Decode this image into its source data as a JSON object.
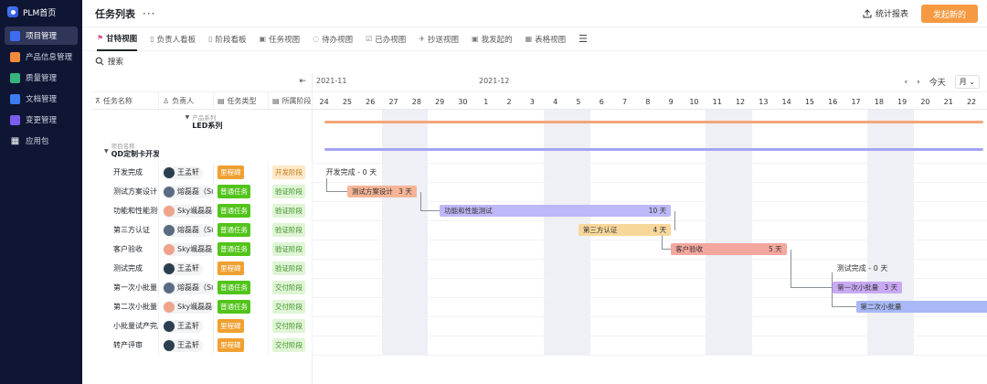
{
  "sidebar": {
    "brand": "PLM首页",
    "items": [
      {
        "label": "项目管理",
        "icon": "project-icon",
        "color": "#3d6cf0",
        "active": true
      },
      {
        "label": "产品信息管理",
        "icon": "product-icon",
        "color": "#f08a3d",
        "active": false
      },
      {
        "label": "质量管理",
        "icon": "quality-icon",
        "color": "#36b37e",
        "active": false
      },
      {
        "label": "文档管理",
        "icon": "document-icon",
        "color": "#3d7cf0",
        "active": false
      },
      {
        "label": "变更管理",
        "icon": "change-icon",
        "color": "#7b5cf0",
        "active": false
      },
      {
        "label": "应用包",
        "icon": "apps-grid-icon",
        "color": "#0f1633",
        "active": false
      }
    ]
  },
  "header": {
    "title": "任务列表",
    "more": "···",
    "stats_label": "统计报表",
    "create_label": "发起新的"
  },
  "tabs": [
    {
      "label": "甘特视图",
      "icon": "gantt-icon",
      "active": true
    },
    {
      "label": "负责人看板",
      "icon": "board-icon",
      "active": false
    },
    {
      "label": "阶段看板",
      "icon": "stage-board-icon",
      "active": false
    },
    {
      "label": "任务视图",
      "icon": "task-view-icon",
      "active": false
    },
    {
      "label": "待办视图",
      "icon": "todo-icon",
      "active": false
    },
    {
      "label": "已办视图",
      "icon": "done-icon",
      "active": false
    },
    {
      "label": "抄送视图",
      "icon": "cc-icon",
      "active": false
    },
    {
      "label": "我发起的",
      "icon": "initiated-icon",
      "active": false
    },
    {
      "label": "表格视图",
      "icon": "table-icon",
      "active": false
    }
  ],
  "search": {
    "label": "搜索"
  },
  "table": {
    "columns": [
      "任务名称",
      "负责人",
      "任务类型",
      "所属阶段"
    ],
    "group1": {
      "sub": "产品系列",
      "main": "LED系列"
    },
    "group2": {
      "sub": "项目名称",
      "main": "QD定制卡开发"
    },
    "rows": [
      {
        "name": "开发完成",
        "owner": "王孟轩",
        "avatar": "#2c3e50",
        "type": "里程碑",
        "type_color": "#f0a030",
        "stage": "开发阶段",
        "stage_color": "#fde8c8",
        "stage_text": "#c67a16"
      },
      {
        "name": "测试方案设计",
        "owner": "熔磊磊（Sl",
        "avatar": "#5b6b82",
        "type": "普通任务",
        "type_color": "#52c41a",
        "stage": "验证阶段",
        "stage_color": "#dff5d6",
        "stage_text": "#3c8f22"
      },
      {
        "name": "功能和性能测试",
        "owner": "Sky颯磊磊",
        "avatar": "#f0a48a",
        "type": "普通任务",
        "type_color": "#52c41a",
        "stage": "验证阶段",
        "stage_color": "#dff5d6",
        "stage_text": "#3c8f22"
      },
      {
        "name": "第三方认证",
        "owner": "熔磊磊（Sl",
        "avatar": "#5b6b82",
        "type": "普通任务",
        "type_color": "#52c41a",
        "stage": "验证阶段",
        "stage_color": "#dff5d6",
        "stage_text": "#3c8f22"
      },
      {
        "name": "客户验收",
        "owner": "Sky颯磊磊",
        "avatar": "#f0a48a",
        "type": "普通任务",
        "type_color": "#52c41a",
        "stage": "验证阶段",
        "stage_color": "#dff5d6",
        "stage_text": "#3c8f22"
      },
      {
        "name": "测试完成",
        "owner": "王孟轩",
        "avatar": "#2c3e50",
        "type": "里程碑",
        "type_color": "#f0a030",
        "stage": "验证阶段",
        "stage_color": "#dff5d6",
        "stage_text": "#3c8f22"
      },
      {
        "name": "第一次小批量",
        "owner": "熔磊磊（Sl",
        "avatar": "#5b6b82",
        "type": "普通任务",
        "type_color": "#52c41a",
        "stage": "交付阶段",
        "stage_color": "#dff5d6",
        "stage_text": "#3c8f22"
      },
      {
        "name": "第二次小批量",
        "owner": "Sky颯磊磊",
        "avatar": "#f0a48a",
        "type": "普通任务",
        "type_color": "#52c41a",
        "stage": "交付阶段",
        "stage_color": "#dff5d6",
        "stage_text": "#3c8f22"
      },
      {
        "name": "小批量试产完成",
        "owner": "王孟轩",
        "avatar": "#2c3e50",
        "type": "里程碑",
        "type_color": "#f0a030",
        "stage": "交付阶段",
        "stage_color": "#dff5d6",
        "stage_text": "#3c8f22"
      },
      {
        "name": "转产评审",
        "owner": "王孟轩",
        "avatar": "#2c3e50",
        "type": "里程碑",
        "type_color": "#f0a030",
        "stage": "交付阶段",
        "stage_color": "#dff5d6",
        "stage_text": "#3c8f22"
      }
    ]
  },
  "gantt": {
    "month1": "2021-11",
    "month2": "2021-12",
    "today_label": "今天",
    "scale_label": "月",
    "days": [
      "24",
      "25",
      "26",
      "27",
      "28",
      "29",
      "30",
      "1",
      "2",
      "3",
      "4",
      "5",
      "6",
      "7",
      "8",
      "9",
      "10",
      "11",
      "12",
      "13",
      "14",
      "15",
      "16",
      "17",
      "18",
      "19",
      "20",
      "21",
      "22"
    ],
    "weekend_day_indices": [
      3,
      10,
      17,
      24
    ],
    "summary_bars": [
      {
        "start": 0.5,
        "end": 29,
        "color": "#f4a578"
      },
      {
        "start": 0.5,
        "end": 29,
        "color": "#a6a3f5"
      }
    ],
    "bars": [
      {
        "row": 1,
        "start": 1.5,
        "end": 4.5,
        "label": "测试方案设计",
        "days_label": "3 天",
        "color": "#f6b597"
      },
      {
        "row": 2,
        "start": 5.5,
        "end": 15.5,
        "label": "功能和性能测试",
        "days_label": "10 天",
        "color": "#bdb8f7"
      },
      {
        "row": 3,
        "start": 11.5,
        "end": 15.5,
        "label": "第三方认证",
        "days_label": "4 天",
        "color": "#f8d79b"
      },
      {
        "row": 4,
        "start": 15.5,
        "end": 20.5,
        "label": "客户验收",
        "days_label": "5 天",
        "color": "#f4a79e"
      },
      {
        "row": 6,
        "start": 22.5,
        "end": 25.5,
        "label": "第一次小批量",
        "days_label": "3 天",
        "color": "#c9a9f4"
      },
      {
        "row": 7,
        "start": 23.5,
        "end": 29.5,
        "label": "第二次小批量",
        "days_label": "",
        "color": "#a9b8f6"
      }
    ],
    "milestones": [
      {
        "row": 0,
        "day": 0.5,
        "label": "开发完成 - 0 天"
      },
      {
        "row": 5,
        "day": 22.6,
        "label": "测试完成 - 0 天"
      }
    ]
  }
}
